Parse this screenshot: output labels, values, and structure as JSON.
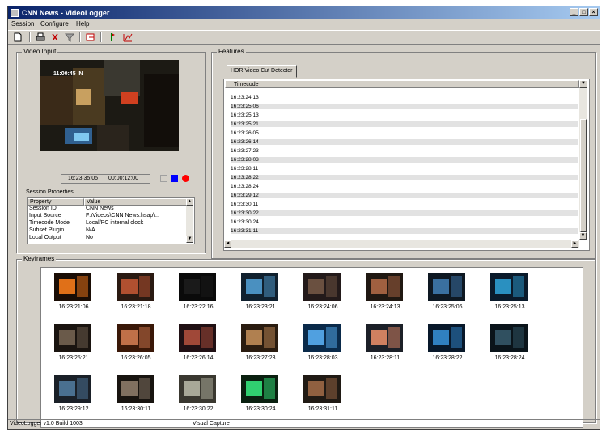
{
  "window": {
    "title": "CNN News - VideoLogger"
  },
  "menu": [
    "Session",
    "Configure",
    "Help"
  ],
  "toolbar": {
    "icons": [
      "new-icon",
      "print-icon",
      "scissors-icon",
      "funnel-icon",
      "export-icon",
      "marker-icon",
      "chart-icon"
    ]
  },
  "video_input": {
    "label": "Video Input",
    "overlay_text": "11:00:45 IN",
    "timecode_current": "16:23:35:05",
    "timecode_elapsed": "00:00:12:00",
    "colors": {
      "stop": "#0000ff",
      "record": "#ff0000"
    }
  },
  "session_properties": {
    "label": "Session Properties",
    "columns": [
      "Property",
      "Value"
    ],
    "rows": [
      [
        "Session ID",
        "CNN News"
      ],
      [
        "Input Source",
        "F:\\Videos\\CNN News.hsap\\..."
      ],
      [
        "Timecode Mode",
        "Local/PC internal clock"
      ],
      [
        "Subset Plugin",
        "N/A"
      ],
      [
        "Local Output",
        "No"
      ]
    ]
  },
  "features": {
    "label": "Features",
    "tab": "HOR Video Cut Detector",
    "column": "Timecode",
    "timecodes": [
      "16:23:24:13",
      "16:23:25:06",
      "16:23:25:13",
      "16:23:25:21",
      "16:23:26:05",
      "16:23:26:14",
      "16:23:27:23",
      "16:23:28:03",
      "16:23:28:11",
      "16:23:28:22",
      "16:23:28:24",
      "16:23:29:12",
      "16:23:30:11",
      "16:23:30:22",
      "16:23:30:24",
      "16:23:31:11"
    ]
  },
  "keyframes": {
    "label": "Keyframes",
    "items": [
      {
        "tc": "16:23:21:06",
        "bg": "#1a0d05",
        "fg": "#e07018"
      },
      {
        "tc": "16:23:21:18",
        "bg": "#2a1a12",
        "fg": "#b05030"
      },
      {
        "tc": "16:23:22:16",
        "bg": "#0a0a0a",
        "fg": "#1a1a1a"
      },
      {
        "tc": "16:23:23:21",
        "bg": "#10202e",
        "fg": "#4a90c0"
      },
      {
        "tc": "16:23:24:06",
        "bg": "#231a1a",
        "fg": "#6a5040"
      },
      {
        "tc": "16:23:24:13",
        "bg": "#201812",
        "fg": "#a06040"
      },
      {
        "tc": "16:23:25:06",
        "bg": "#0e1822",
        "fg": "#3a70a0"
      },
      {
        "tc": "16:23:25:13",
        "bg": "#0a1a2a",
        "fg": "#2a90c0"
      },
      {
        "tc": "16:23:25:21",
        "bg": "#1a1410",
        "fg": "#6a5a4a"
      },
      {
        "tc": "16:23:26:05",
        "bg": "#3a1808",
        "fg": "#c07048"
      },
      {
        "tc": "16:23:26:14",
        "bg": "#201014",
        "fg": "#a04838"
      },
      {
        "tc": "16:23:27:23",
        "bg": "#2a1c10",
        "fg": "#b08050"
      },
      {
        "tc": "16:23:28:03",
        "bg": "#0a2a4a",
        "fg": "#50a0e0"
      },
      {
        "tc": "16:23:28:11",
        "bg": "#1c2028",
        "fg": "#d08060"
      },
      {
        "tc": "16:23:28:22",
        "bg": "#08182a",
        "fg": "#3080c0"
      },
      {
        "tc": "16:23:28:24",
        "bg": "#0a141a",
        "fg": "#305060"
      },
      {
        "tc": "16:23:29:12",
        "bg": "#1a2028",
        "fg": "#4a7090"
      },
      {
        "tc": "16:23:30:11",
        "bg": "#181410",
        "fg": "#807060"
      },
      {
        "tc": "16:23:30:22",
        "bg": "#3a3830",
        "fg": "#a8a898"
      },
      {
        "tc": "16:23:30:24",
        "bg": "#0a2010",
        "fg": "#30d070"
      },
      {
        "tc": "16:23:31:11",
        "bg": "#201a14",
        "fg": "#906040"
      }
    ]
  },
  "status": {
    "left": "VideoLogger v1.0 Build 1003",
    "middle": "Visual Capture"
  }
}
